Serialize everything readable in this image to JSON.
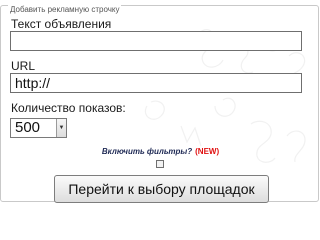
{
  "form": {
    "legend": "Добавить рекламную строчку",
    "ad_text_label": "Текст объявления",
    "ad_text_value": "",
    "url_label": "URL",
    "url_value": "http://",
    "impressions_label": "Количество показов:",
    "impressions_value": "500",
    "filters_label": "Включить фильтры?",
    "filters_badge": "(NEW)",
    "filters_checked": false,
    "submit_label": "Перейти к выбору площадок"
  },
  "icons": {
    "select_arrow": "chevron-down-icon"
  },
  "colors": {
    "filters_label": "#1f2a55",
    "new_badge": "#e01010"
  }
}
